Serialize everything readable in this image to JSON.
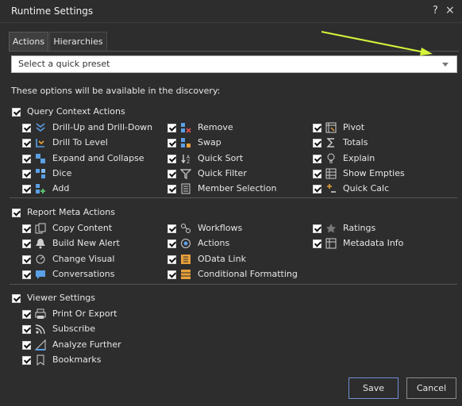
{
  "window": {
    "title": "Runtime Settings",
    "help": "?",
    "close": "×"
  },
  "tabs": [
    {
      "label": "Actions",
      "active": true
    },
    {
      "label": "Hierarchies",
      "active": false
    }
  ],
  "preset": {
    "placeholder": "Select a quick preset"
  },
  "note": "These options will be available in the discovery:",
  "groups": [
    {
      "label": "Query Context Actions",
      "checked": true,
      "items": [
        [
          {
            "label": "Drill-Up and Drill-Down",
            "icon": "drill-up-down-icon",
            "checked": true
          },
          {
            "label": "Remove",
            "icon": "remove-icon",
            "checked": true
          },
          {
            "label": "Pivot",
            "icon": "pivot-icon",
            "checked": true
          }
        ],
        [
          {
            "label": "Drill To Level",
            "icon": "drill-to-level-icon",
            "checked": true
          },
          {
            "label": "Swap",
            "icon": "swap-icon",
            "checked": true
          },
          {
            "label": "Totals",
            "icon": "sigma-icon",
            "checked": true
          }
        ],
        [
          {
            "label": "Expand and Collapse",
            "icon": "expand-collapse-icon",
            "checked": true
          },
          {
            "label": "Quick Sort",
            "icon": "sort-icon",
            "checked": true
          },
          {
            "label": "Explain",
            "icon": "lightbulb-icon",
            "checked": true
          }
        ],
        [
          {
            "label": "Dice",
            "icon": "dice-icon",
            "checked": true
          },
          {
            "label": "Quick Filter",
            "icon": "filter-icon",
            "checked": true
          },
          {
            "label": "Show Empties",
            "icon": "show-empties-icon",
            "checked": true
          }
        ],
        [
          {
            "label": "Add",
            "icon": "add-icon",
            "checked": true
          },
          {
            "label": "Member Selection",
            "icon": "member-selection-icon",
            "checked": true
          },
          {
            "label": "Quick Calc",
            "icon": "quick-calc-icon",
            "checked": true
          }
        ]
      ]
    },
    {
      "label": "Report Meta Actions",
      "checked": true,
      "items": [
        [
          {
            "label": "Copy Content",
            "icon": "copy-icon",
            "checked": true
          },
          {
            "label": "Workflows",
            "icon": "workflows-icon",
            "checked": true
          },
          {
            "label": "Ratings",
            "icon": "star-icon",
            "checked": true
          }
        ],
        [
          {
            "label": "Build New Alert",
            "icon": "alert-icon",
            "checked": true
          },
          {
            "label": "Actions",
            "icon": "actions-icon",
            "checked": true
          },
          {
            "label": "Metadata Info",
            "icon": "metadata-icon",
            "checked": true
          }
        ],
        [
          {
            "label": "Change Visual",
            "icon": "change-visual-icon",
            "checked": true
          },
          {
            "label": "OData Link",
            "icon": "odata-icon",
            "checked": true
          }
        ],
        [
          {
            "label": "Conversations",
            "icon": "conversations-icon",
            "checked": true
          },
          {
            "label": "Conditional Formatting",
            "icon": "conditional-formatting-icon",
            "checked": true
          }
        ]
      ]
    },
    {
      "label": "Viewer Settings",
      "checked": true,
      "items": [
        [
          {
            "label": "Print Or Export",
            "icon": "print-icon",
            "checked": true
          }
        ],
        [
          {
            "label": "Subscribe",
            "icon": "rss-icon",
            "checked": true
          }
        ],
        [
          {
            "label": "Analyze Further",
            "icon": "analyze-icon",
            "checked": true
          }
        ],
        [
          {
            "label": "Bookmarks",
            "icon": "bookmark-icon",
            "checked": true
          }
        ]
      ]
    }
  ],
  "buttons": {
    "save": "Save",
    "cancel": "Cancel"
  },
  "annotation": {
    "arrow_color": "#d4f53a"
  }
}
